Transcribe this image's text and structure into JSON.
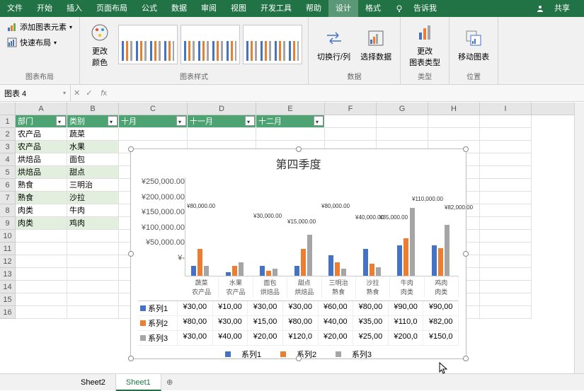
{
  "tabs": {
    "file": "文件",
    "home": "开始",
    "insert": "插入",
    "layout": "页面布局",
    "formula": "公式",
    "data": "数据",
    "review": "审阅",
    "view": "视图",
    "dev": "开发工具",
    "help": "帮助",
    "design": "设计",
    "format": "格式",
    "tell": "告诉我",
    "share": "共享"
  },
  "ribbon": {
    "addElem": "添加图表元素",
    "quickLayout": "快速布局",
    "changeColor": "更改\n颜色",
    "switchRowCol": "切换行/列",
    "selectData": "选择数据",
    "changeType": "更改\n图表类型",
    "moveChart": "移动图表",
    "g1": "图表布局",
    "g2": "图表样式",
    "g3": "数据",
    "g4": "类型",
    "g5": "位置"
  },
  "namebox": "图表 4",
  "headers": [
    "部门",
    "类别",
    "十月",
    "十一月",
    "十二月"
  ],
  "rows": [
    [
      "农产品",
      "蔬菜"
    ],
    [
      "农产品",
      "水果"
    ],
    [
      "烘焙品",
      "面包"
    ],
    [
      "烘焙品",
      "甜点"
    ],
    [
      "熟食",
      "三明治"
    ],
    [
      "熟食",
      "沙拉"
    ],
    [
      "肉类",
      "牛肉"
    ],
    [
      "肉类",
      "鸡肉"
    ]
  ],
  "sheets": {
    "s2": "Sheet2",
    "s1": "Sheet1"
  },
  "chart_data": {
    "type": "bar",
    "title": "第四季度",
    "ylabels": [
      "¥250,000.00",
      "¥200,000.00",
      "¥150,000.00",
      "¥100,000.00",
      "¥50,000.00",
      "¥-"
    ],
    "categories": [
      "蔬菜",
      "水果",
      "面包",
      "甜点",
      "三明治",
      "沙拉",
      "牛肉",
      "鸡肉"
    ],
    "categories2": [
      "农产品",
      "农产品",
      "烘焙品",
      "烘焙品",
      "熟食",
      "熟食",
      "肉类",
      "肉类"
    ],
    "data_labels": [
      "¥80,000.00",
      "",
      "¥30,000.00",
      "¥15,000.00",
      "¥80,000.00",
      "¥40,000.00",
      "¥35,000.00",
      "¥110,000.00",
      "¥82,000.00"
    ],
    "series": [
      {
        "name": "系列1",
        "values": [
          30000,
          10000,
          30000,
          30000,
          60000,
          80000,
          90000,
          90000
        ],
        "display": [
          "¥30,00",
          "¥10,00",
          "¥30,00",
          "¥30,00",
          "¥60,00",
          "¥80,00",
          "¥90,00",
          "¥90,00"
        ]
      },
      {
        "name": "系列2",
        "values": [
          80000,
          30000,
          15000,
          80000,
          40000,
          35000,
          110000,
          82000
        ],
        "display": [
          "¥80,00",
          "¥30,00",
          "¥15,00",
          "¥80,00",
          "¥40,00",
          "¥35,00",
          "¥110,0",
          "¥82,00"
        ]
      },
      {
        "name": "系列3",
        "values": [
          30000,
          40000,
          20000,
          120000,
          20000,
          25000,
          200000,
          150000
        ],
        "display": [
          "¥30,00",
          "¥40,00",
          "¥20,00",
          "¥120,0",
          "¥20,00",
          "¥25,00",
          "¥200,0",
          "¥150,0"
        ]
      }
    ],
    "ylim": [
      0,
      250000
    ]
  }
}
